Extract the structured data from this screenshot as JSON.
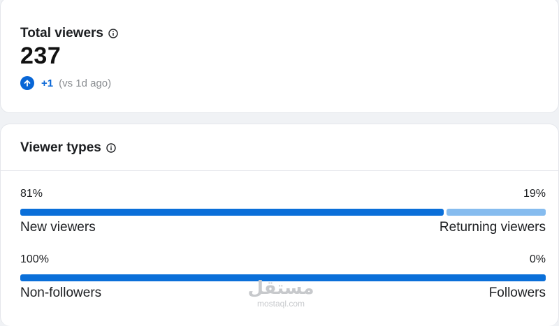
{
  "total_viewers": {
    "title": "Total viewers",
    "value": "237",
    "delta": "+1",
    "compare": "(vs 1d ago)",
    "icons": {
      "info": "info-icon",
      "trend": "arrow-up-icon"
    }
  },
  "viewer_types": {
    "title": "Viewer types",
    "metrics": [
      {
        "left_pct": "81%",
        "right_pct": "19%",
        "left_label": "New viewers",
        "right_label": "Returning viewers",
        "left_fraction": 0.81,
        "right_fraction": 0.19
      },
      {
        "left_pct": "100%",
        "right_pct": "0%",
        "left_label": "Non-followers",
        "right_label": "Followers",
        "left_fraction": 1.0,
        "right_fraction": 0.0
      }
    ]
  },
  "watermark": {
    "arabic": "مستقل",
    "latin": "mostaql.com"
  },
  "colors": {
    "accent": "#0866d6",
    "bar_primary": "#0a6fd9",
    "bar_secondary": "#86bcef",
    "muted_text": "#8a8d91"
  }
}
